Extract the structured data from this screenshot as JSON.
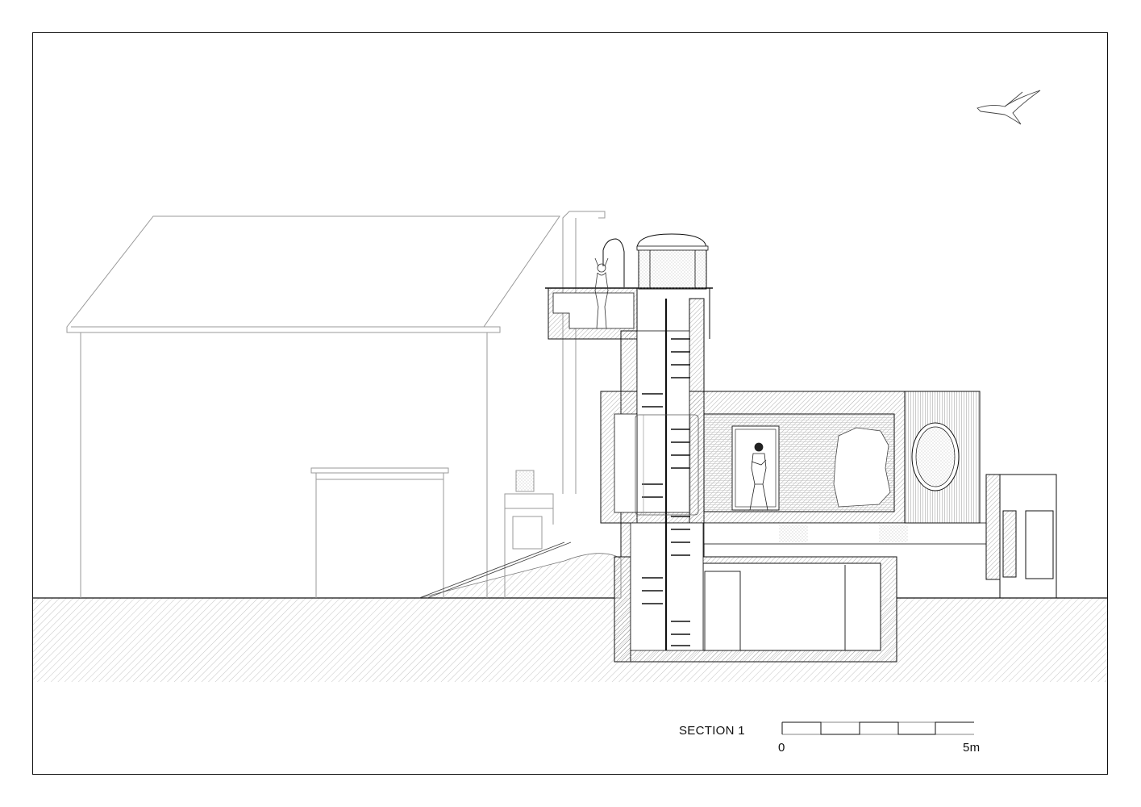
{
  "section_label": "SECTION 1",
  "scale_bar": {
    "start_label": "0",
    "end_label": "5m"
  },
  "colors": {
    "line": "#111111",
    "context_line": "#9a9a9a",
    "hatch": "#b5b5b5",
    "fill": "#ffffff"
  }
}
